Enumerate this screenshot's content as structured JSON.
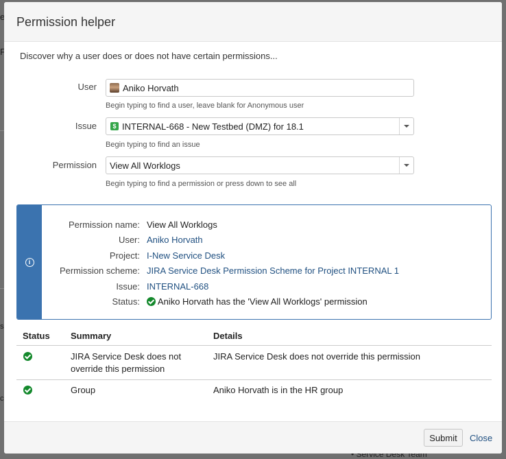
{
  "dialog": {
    "title": "Permission helper",
    "intro": "Discover why a user does or does not have certain permissions..."
  },
  "form": {
    "user": {
      "label": "User",
      "value": "Aniko Horvath",
      "hint": "Begin typing to find a user, leave blank for Anonymous user"
    },
    "issue": {
      "label": "Issue",
      "value": "INTERNAL-668 - New Testbed (DMZ) for 18.1",
      "hint": "Begin typing to find an issue"
    },
    "permission": {
      "label": "Permission",
      "value": "View All Worklogs",
      "hint": "Begin typing to find a permission or press down to see all"
    }
  },
  "result": {
    "permission_name_label": "Permission name:",
    "permission_name": "View All Worklogs",
    "user_label": "User:",
    "user": "Aniko Horvath",
    "project_label": "Project:",
    "project": "I-New Service Desk",
    "scheme_label": "Permission scheme:",
    "scheme": "JIRA Service Desk Permission Scheme for Project INTERNAL 1",
    "issue_label": "Issue:",
    "issue": "INTERNAL-668",
    "status_label": "Status:",
    "status": "Aniko Horvath has the 'View All Worklogs' permission"
  },
  "table": {
    "headers": {
      "status": "Status",
      "summary": "Summary",
      "details": "Details"
    },
    "rows": [
      {
        "summary_line1": "JIRA Service Desk does not",
        "summary_line2": "override this permission",
        "details": "JIRA Service Desk does not override this permission"
      },
      {
        "summary_line1": "Group",
        "details": "Aniko Horvath is in the HR group"
      }
    ]
  },
  "footer": {
    "submit": "Submit",
    "close": "Close"
  },
  "background": {
    "peek_text": "Service Desk Team"
  },
  "colors": {
    "link": "#205081",
    "info": "#3b73af",
    "success": "#14892c"
  }
}
